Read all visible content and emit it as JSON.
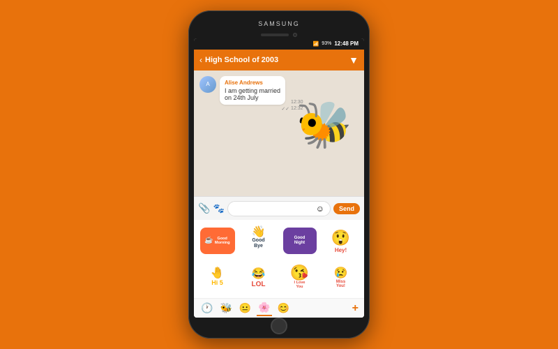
{
  "phone": {
    "brand": "SAMSUNG",
    "status_bar": {
      "signal": "📶",
      "battery_pct": "93%",
      "time": "12:48 PM"
    },
    "chat_header": {
      "back_label": "‹",
      "title": "High School of 2003",
      "dropdown_icon": "▼"
    },
    "chat": {
      "message": {
        "sender": "Alise Andrews",
        "time_top": "12:30",
        "text": "I am getting married\non 24th July",
        "checkmarks": "✓✓",
        "time_bottom": "12:32"
      }
    },
    "input_bar": {
      "attach_icon": "📎",
      "sticker_icon": "🐾",
      "emoji_icon": "☺",
      "send_label": "Send"
    },
    "sticker_panel": {
      "row1": [
        {
          "type": "good-morning",
          "label": "Good Morning"
        },
        {
          "type": "goodbye",
          "label": "Good Bye"
        },
        {
          "type": "good-night",
          "label": "Good Night"
        },
        {
          "type": "hey",
          "label": "Hey!"
        }
      ],
      "row2": [
        {
          "type": "hi5",
          "label": "Hi 5"
        },
        {
          "type": "lol",
          "label": "LOL"
        },
        {
          "type": "iloveyou",
          "label": "I Love You"
        },
        {
          "type": "missyou",
          "label": "Miss You!"
        }
      ],
      "tabs": [
        {
          "icon": "🕐",
          "active": false
        },
        {
          "icon": "🐝",
          "active": false
        },
        {
          "icon": "😐",
          "active": false
        },
        {
          "icon": "🌸",
          "active": true
        },
        {
          "icon": "😊",
          "active": false
        }
      ],
      "add_label": "+"
    }
  }
}
